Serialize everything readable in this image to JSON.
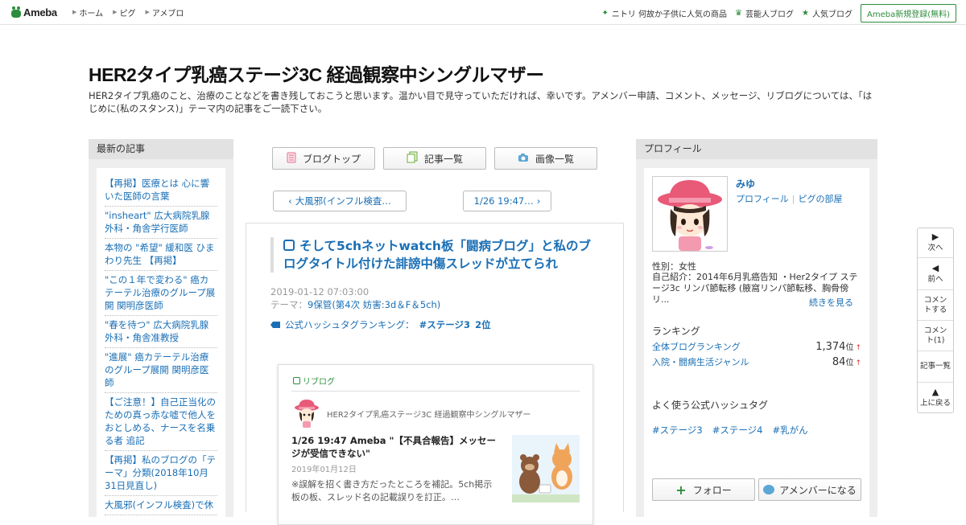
{
  "topbar": {
    "logo": "Ameba",
    "nav": [
      "ホーム",
      "ピグ",
      "アメブロ"
    ],
    "right_links": [
      {
        "icon": "sparkle-icon",
        "label": "ニトリ 何故か子供に人気の商品"
      },
      {
        "icon": "crown-icon",
        "label": "芸能人ブログ"
      },
      {
        "icon": "star-icon",
        "label": "人気ブログ"
      }
    ],
    "signup": "Ameba新規登録(無料)"
  },
  "header": {
    "title": "HER2タイプ乳癌ステージ3C 経過観察中シングルマザー",
    "description": "HER2タイプ乳癌のこと、治療のことなどを書き残しておこうと思います。温かい目で見守っていただければ、幸いです。アメンバー申請、コメント、メッセージ、リブログについては、「はじめに(私のスタンス)」テーマ内の記事をご一読下さい。"
  },
  "left": {
    "heading": "最新の記事",
    "items": [
      "【再掲】医療とは 心に響いた医師の言葉",
      "\"insheart\" 広大病院乳腺外科・角舎学行医師",
      "本物の \"希望\" 緩和医 ひまわり先生 【再掲】",
      "\"この１年で変わる\" 癌カテーテル治療のグループ展開 関明彦医師",
      "\"春を待つ\" 広大病院乳腺外科・角舎准教授",
      "\"進展\" 癌カテーテル治療のグループ展開 関明彦医師",
      "【ご注意！】自己正当化のための真っ赤な嘘で他人をおとしめる、ナースを名乗る者 追記",
      "【再掲】私のブログの「テーマ」分類(2018年10月31日見直し)",
      "大風邪(インフル検査)で休"
    ]
  },
  "center": {
    "buttons": {
      "blog_top": "ブログトップ",
      "entry_list": "記事一覧",
      "image_list": "画像一覧"
    },
    "prev": "大風邪(インフル検査…",
    "next": "1/26 19:47…",
    "article": {
      "title": "そして5chネットwatch板「闘病ブログ」と私のブログタイトル付けた誹謗中傷スレッドが立てられ",
      "datetime": "2019-01-12 07:03:00",
      "theme_label": "テーマ：",
      "theme": "9保管(第4次 妨害:3d＆F＆5ch)",
      "hashtag_rank_label": "公式ハッシュタグランキング：",
      "hashtag_rank_tag": "#ステージ3",
      "hashtag_rank_value": "2位"
    },
    "reblog": {
      "label": "リブログ",
      "blog_name": "HER2タイプ乳癌ステージ3C 経過観察中シングルマザー",
      "entry_title": "1/26 19:47 Ameba \"【不具合報告】メッセージが受信できない\"",
      "date": "2019年01月12日",
      "text": "※誤解を招く書き方だったところを補記。5ch掲示板の板、スレッド名の記載誤りを訂正。…"
    }
  },
  "right": {
    "heading": "プロフィール",
    "name": "みゆ",
    "links": [
      "プロフィール",
      "ピグの部屋"
    ],
    "gender": "性別：女性",
    "intro": "自己紹介：2014年6月乳癌告知 ・Her2タイプ ステージ3c リンパ節転移 (腋窩リンパ節転移、胸骨傍リ...",
    "more": "続きを見る",
    "ranking_heading": "ランキング",
    "rankings": [
      {
        "label": "全体ブログランキング",
        "value": "1,374",
        "unit": "位",
        "arrow": "↑"
      },
      {
        "label": "入院・闘病生活ジャンル",
        "value": "84",
        "unit": "位",
        "arrow": "↑"
      }
    ],
    "hashtag_heading": "よく使う公式ハッシュタグ",
    "hashtags": [
      "#ステージ3",
      "#ステージ4",
      "#乳がん"
    ],
    "follow": "フォロー",
    "amember": "アメンバーになる"
  },
  "sidemenu": [
    {
      "icon": "arrow-right-icon",
      "label": "次へ"
    },
    {
      "icon": "arrow-left-icon",
      "label": "前へ"
    },
    {
      "label": "コメントする"
    },
    {
      "label": "コメント(1)"
    },
    {
      "label": "記事一覧"
    },
    {
      "icon": "arrow-up-icon",
      "label": "上に戻る"
    }
  ],
  "colors": {
    "brand": "#2d8c3c",
    "link": "#1a6fb5"
  }
}
